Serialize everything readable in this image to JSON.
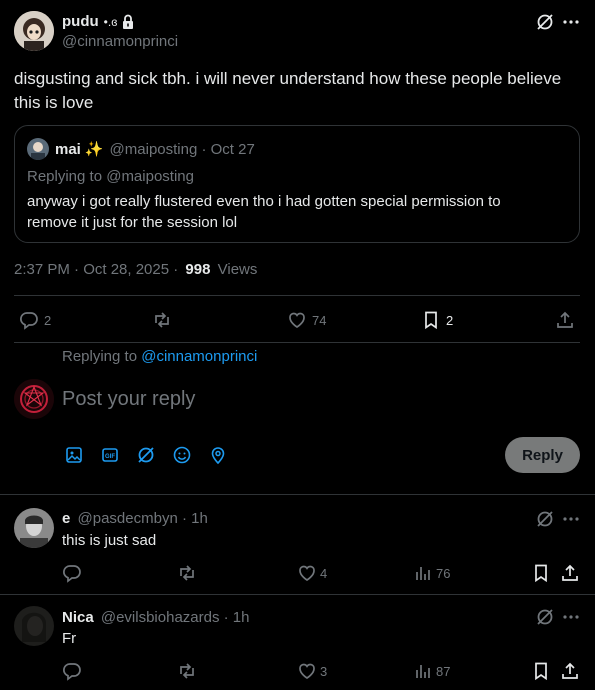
{
  "main_post": {
    "display_name": "pudu",
    "name_emoji": "•.ɞ",
    "handle": "@cinnamonprinci",
    "text": "disgusting and sick tbh. i will never understand how these people believe this is love",
    "timestamp": "2:37 PM · Oct 28, 2025 ·",
    "views_count": "998",
    "views_label": "Views",
    "stats": {
      "replies": "2",
      "likes": "74",
      "bookmarks": "2"
    }
  },
  "quoted": {
    "display_name": "mai",
    "emoji": "✨",
    "handle": "@maiposting · Oct 27",
    "replying_to": "Replying to @maiposting",
    "text": "anyway i got really flustered even tho i had gotten special permission to remove it just for the session lol"
  },
  "composer": {
    "replying_prefix": "Replying to",
    "replying_handle": "@cinnamonprinci",
    "placeholder": "Post your reply",
    "reply_button": "Reply"
  },
  "replies": [
    {
      "display_name": "e",
      "meta": "@pasdecmbyn · 1h",
      "text": "this is just sad",
      "likes": "4",
      "views": "76"
    },
    {
      "display_name": "Nica",
      "meta": "@evilsbiohazards · 1h",
      "text": "Fr",
      "likes": "3",
      "views": "87"
    }
  ],
  "colors": {
    "accent": "#1d9bf0",
    "muted": "#71767b",
    "divider": "#2f3336",
    "button_bg": "#787a7a"
  }
}
